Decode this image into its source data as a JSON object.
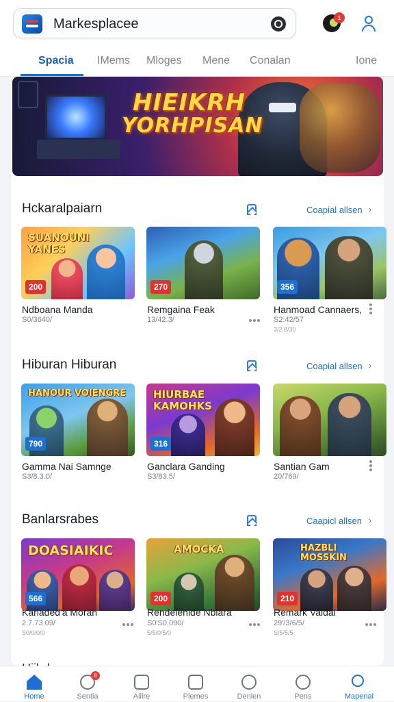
{
  "header": {
    "title": "Markesplacee",
    "notification_count": "1"
  },
  "tabs": [
    {
      "label": "Spacia",
      "active": true
    },
    {
      "label": "IMems",
      "active": false
    },
    {
      "label": "Mloges",
      "active": false
    },
    {
      "label": "Mene",
      "active": false
    },
    {
      "label": "Conalan",
      "active": false
    },
    {
      "label": "Ione",
      "active": false
    }
  ],
  "hero": {
    "line1": "HIEIKRH",
    "line2": "YORHPISAN"
  },
  "sections": [
    {
      "title": "Hckaralpaiarn",
      "see_all": "Coapial allsen",
      "games": [
        {
          "art_text": "SUANOUNI YANES",
          "price": "200",
          "price_color": "#e0322f",
          "name": "Ndboana Manda",
          "sub": "S0/3640/",
          "sub2": ""
        },
        {
          "art_text": "",
          "price": "270",
          "price_color": "#e0322f",
          "name": "Remgaina Feak",
          "sub": "13/42.3/",
          "sub2": ""
        },
        {
          "art_text": "",
          "price": "356",
          "price_color": "#1f6fd0",
          "name": "Hanmoad Cannaers,",
          "sub": "S2:42/57",
          "sub2": "3/2 8/30"
        }
      ]
    },
    {
      "title": "Hiburan Hiburan",
      "see_all": "Coapial allsen",
      "games": [
        {
          "art_text": "HANOUR VOIENGRE",
          "price": "790",
          "price_color": "#1f6fd0",
          "name": "Gamma Nai Samnge",
          "sub": "S3/8.3.0/",
          "sub2": ""
        },
        {
          "art_text": "HIURBAE KAMOHKS",
          "price": "316",
          "price_color": "#1f6fd0",
          "name": "Ganclara Ganding",
          "sub": "S3/83.5/",
          "sub2": ""
        },
        {
          "art_text": "",
          "price": "",
          "price_color": "#1f6fd0",
          "name": "Santian Gam",
          "sub": "20/769/",
          "sub2": ""
        }
      ]
    },
    {
      "title": "Banlarsrabes",
      "see_all": "Caapicl allsen",
      "games": [
        {
          "art_text": "DOASIAIKIC",
          "price": "566",
          "price_color": "#1f6fd0",
          "name": "Karladed'a Moran",
          "sub": "2.7.73.09/",
          "sub2": "S0/0/0/0"
        },
        {
          "art_text": "AMOCKA",
          "price": "200",
          "price_color": "#e0322f",
          "name": "Rendelenide Nblara",
          "sub": "S0'S0.090/",
          "sub2": "5/5/0/5/0"
        },
        {
          "art_text": "HAZBLI MOSSKIN",
          "price": "210",
          "price_color": "#e0322f",
          "name": "Remark Valdai",
          "sub": "29'/3/6/5/",
          "sub2": "S/5/5/5"
        }
      ]
    }
  ],
  "peek_title": "Hiibrl",
  "bottom_nav": [
    {
      "label": "Home",
      "icon": "home-icon",
      "active": true
    },
    {
      "label": "Sentia",
      "icon": "chat-icon",
      "active": false,
      "badge": "8"
    },
    {
      "label": "Alilre",
      "icon": "library-icon",
      "active": false
    },
    {
      "label": "Plemes",
      "icon": "wallet-icon",
      "active": false
    },
    {
      "label": "Denlen",
      "icon": "refresh-icon",
      "active": false
    },
    {
      "label": "Pens",
      "icon": "people-icon",
      "active": false
    },
    {
      "label": "Mapenal",
      "icon": "search-icon",
      "active": true
    }
  ]
}
